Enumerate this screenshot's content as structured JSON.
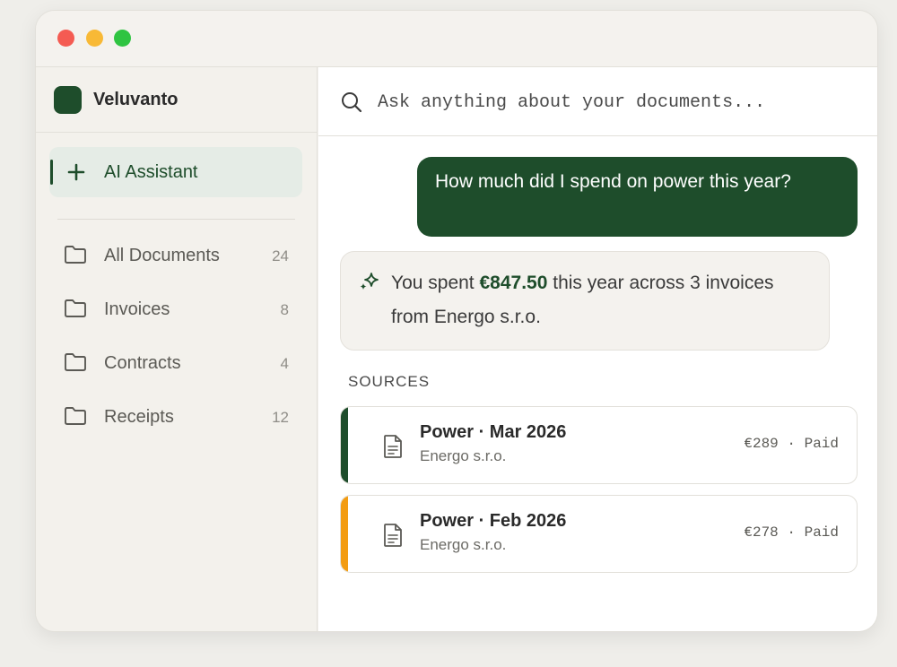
{
  "app": {
    "name": "Veluvanto"
  },
  "colors": {
    "accent": "#1e4d2b",
    "orange": "#f39c12"
  },
  "sidebar": {
    "assistant_label": "AI Assistant",
    "items": [
      {
        "label": "All Documents",
        "count": "24"
      },
      {
        "label": "Invoices",
        "count": "8"
      },
      {
        "label": "Contracts",
        "count": "4"
      },
      {
        "label": "Receipts",
        "count": "12"
      }
    ]
  },
  "search": {
    "placeholder": "Ask anything about your documents..."
  },
  "chat": {
    "user_message": "How much did I spend on power this year?",
    "ai_prefix": "You spent ",
    "ai_amount": "€847.50",
    "ai_suffix": " this year across 3 invoices from Energo s.r.o."
  },
  "sources": {
    "title": "SOURCES",
    "items": [
      {
        "title": "Power · Mar 2026",
        "vendor": "Energo s.r.o.",
        "meta": "€289 · Paid",
        "accent": "#1e4d2b"
      },
      {
        "title": "Power · Feb 2026",
        "vendor": "Energo s.r.o.",
        "meta": "€278 · Paid",
        "accent": "#f39c12"
      }
    ]
  }
}
